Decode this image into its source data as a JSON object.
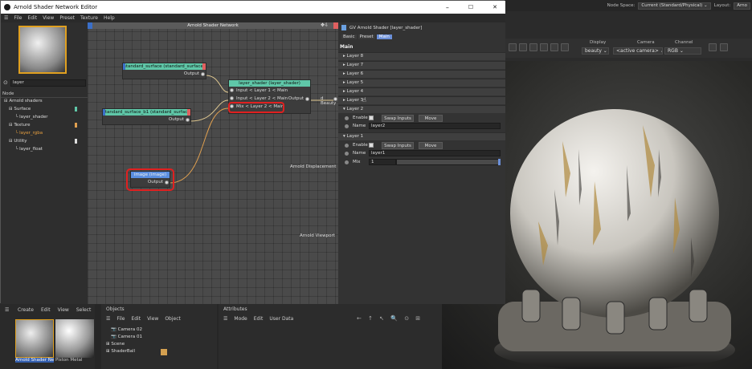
{
  "editor": {
    "title": "Arnold Shader Network Editor",
    "menu": [
      "File",
      "Edit",
      "View",
      "Preset",
      "Texture",
      "Help"
    ],
    "search_value": "layer",
    "tree_header": "Node",
    "tree": [
      {
        "label": "Arnold shaders",
        "indent": 0
      },
      {
        "label": "Surface",
        "indent": 1
      },
      {
        "label": "layer_shader",
        "indent": 2
      },
      {
        "label": "Texture",
        "indent": 1
      },
      {
        "label": "layer_rgba",
        "indent": 2,
        "highlight": true
      },
      {
        "label": "Utility",
        "indent": 1
      },
      {
        "label": "layer_float",
        "indent": 2
      }
    ],
    "graph_title": "Arnold Shader Network",
    "nodes": {
      "standard_surface": {
        "title": "standard_surface (standard_surface)",
        "port": "Output"
      },
      "standard_surface_b1": {
        "title": "standard_surface_b1 (standard_surface)",
        "port": "Output"
      },
      "image": {
        "title": "image (image)",
        "port": "Output"
      },
      "layer_shader": {
        "title": "layer_shader (layer_shader)",
        "inputs": [
          "Input < Layer 1 < Main",
          "Input < Layer 2 < Main",
          "Mix < Layer 2 < Main"
        ],
        "output": "Output"
      }
    },
    "beauty_label": "Beauty",
    "displacement_label": "Arnold Displacement",
    "viewport_label": "Arnold Viewport"
  },
  "attributes": {
    "header": "GV Arnold Shader [layer_shader]",
    "tabs": [
      "Basic",
      "Preset",
      "Main"
    ],
    "active_tab": "Main",
    "section": "Main",
    "collapsed_layers": [
      "Layer 8",
      "Layer 7",
      "Layer 6",
      "Layer 5",
      "Layer 4",
      "Layer 3"
    ],
    "layer2": {
      "title": "Layer 2",
      "enable": "Enable",
      "swap": "Swap Inputs",
      "move": "Move",
      "name_label": "Name",
      "name_value": "layer2"
    },
    "layer1": {
      "title": "Layer 1",
      "enable": "Enable",
      "swap": "Swap Inputs",
      "move": "Move",
      "name_label": "Name",
      "name_value": "layer1",
      "mix_label": "Mix",
      "mix_value": "1"
    }
  },
  "main": {
    "node_space_label": "Node Space:",
    "node_space_value": "Current (Standard/Physical)",
    "layout_label": "Layout:",
    "layout_value": "Arno",
    "display_label": "Display",
    "display_value": "beauty",
    "camera_label": "Camera",
    "camera_value": "<active camera>",
    "channel_label": "Channel",
    "channel_value": "RGB"
  },
  "bottom": {
    "material_menu": [
      "Create",
      "Edit",
      "View",
      "Select"
    ],
    "materials": [
      "Arnold Shader Ne",
      "Piston Metal"
    ],
    "objects_title": "Objects",
    "objects_menu": [
      "File",
      "Edit",
      "View",
      "Object"
    ],
    "objects": [
      "Camera 02",
      "Camera 01",
      "Scene",
      "ShaderBall"
    ],
    "attributes_title": "Attributes",
    "attributes_menu": [
      "Mode",
      "Edit",
      "User Data"
    ]
  },
  "window_controls": {
    "minimize": "–",
    "maximize": "☐",
    "close": "✕"
  }
}
